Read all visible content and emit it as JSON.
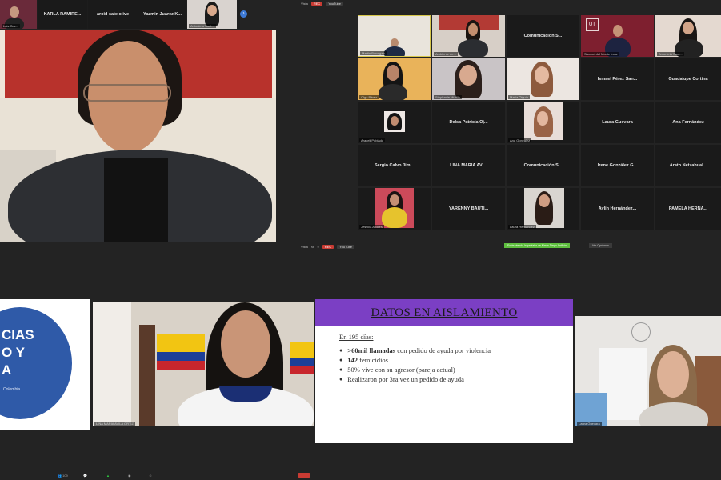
{
  "top_strip": {
    "names": [
      "KARLA RAMIRE...",
      "aroid sate olive",
      "Yazmin Juarez K...",
      "Antonieta Sant..."
    ],
    "left_chip": "Luis Gue..."
  },
  "speaker": {
    "name": ""
  },
  "gallery": {
    "toolbar": {
      "view": "Vista",
      "rec": "REC",
      "live": "YouTube"
    },
    "tiles": [
      {
        "label": "Martin Barragan",
        "video": true
      },
      {
        "label": "Ambiente de...",
        "video": true
      },
      {
        "label": "Comunicación S...",
        "video": false
      },
      {
        "label": "Samuel del Monte Lora",
        "video": true
      },
      {
        "label": "Antonieta Sant...",
        "video": true
      },
      {
        "label": "Olga Pérez",
        "video": true
      },
      {
        "label": "Stephanie Murillo",
        "video": true
      },
      {
        "label": "María Olguín",
        "video": true
      },
      {
        "label": "Ismael Pérez San...",
        "video": false
      },
      {
        "label": "Guadalupe Cortina",
        "video": false
      },
      {
        "label": "Araceli Poblado",
        "video": true
      },
      {
        "label": "Delsa Patricia Oj...",
        "video": false
      },
      {
        "label": "Ana Gonzalez",
        "video": true
      },
      {
        "label": "Laura Guevara",
        "video": false
      },
      {
        "label": "Ana Fernández",
        "video": false
      },
      {
        "label": "Sergio Calvo Jim...",
        "video": false
      },
      {
        "label": "LINA MARIA AVI...",
        "video": false
      },
      {
        "label": "Comunicación S...",
        "video": false
      },
      {
        "label": "Irene González G...",
        "video": false
      },
      {
        "label": "Arath Netzahual...",
        "video": false
      },
      {
        "label": "Jessica Andrés",
        "video": true
      },
      {
        "label": "YARENNY BAUTI...",
        "video": false
      },
      {
        "label": "Laura Hernández",
        "video": true
      },
      {
        "label": "Aylin Hernández...",
        "video": false
      },
      {
        "label": "PAMELA HERNA..."
      }
    ],
    "bottom_toolbar": {
      "view": "Vista",
      "rec": "REC",
      "live": "YouTube",
      "notice": "Estás viendo la pantalla de María Diego Antillón",
      "options": "Ver Opciones"
    }
  },
  "bottom_row": {
    "colombia_slide": [
      "CIAS",
      "O Y",
      "A",
      "Colombia"
    ],
    "lina_label": "LINA MARIA AVILA ORTIZ",
    "laura_label": "Laura Guevara"
  },
  "slide": {
    "title": "DATOS EN AISLAMIENTO",
    "subtitle": "En 195 días:",
    "bullets": [
      {
        "bold": ">60mil llamadas",
        "rest": " con pedido de ayuda por violencia"
      },
      {
        "bold": "142",
        "rest": " femicidios"
      },
      {
        "bold": "",
        "rest": "50% vive con su agresor (pareja actual)"
      },
      {
        "bold": "",
        "rest": "Realizaron por 3ra vez un pedido de ayuda"
      }
    ]
  },
  "bottombar": {
    "participants": "109"
  },
  "colors": {
    "accent_purple": "#7b3fc4",
    "rec_red": "#c93b33"
  }
}
